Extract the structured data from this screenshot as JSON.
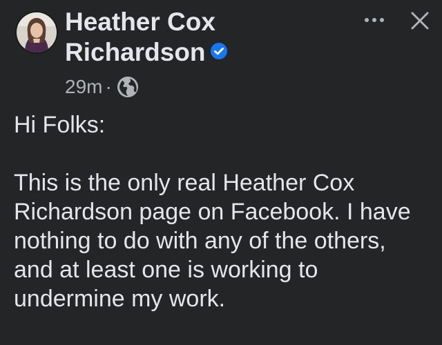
{
  "post": {
    "author": "Heather Cox Richardson",
    "verified": true,
    "timestamp": "29m",
    "separator": "·",
    "audience_icon": "globe-icon",
    "greeting": "Hi Folks:",
    "paragraph": "This is the only real Heather Cox Richardson page on Facebook. I have nothing to do with any of the others, and at least one is working to undermine my work."
  },
  "header_actions": {
    "more_icon": "more-options-icon",
    "close_icon": "close-icon"
  },
  "colors": {
    "background": "#242526",
    "text_primary": "#e4e6eb",
    "text_secondary": "#b0b3b8",
    "verified_badge": "#1877f2"
  }
}
